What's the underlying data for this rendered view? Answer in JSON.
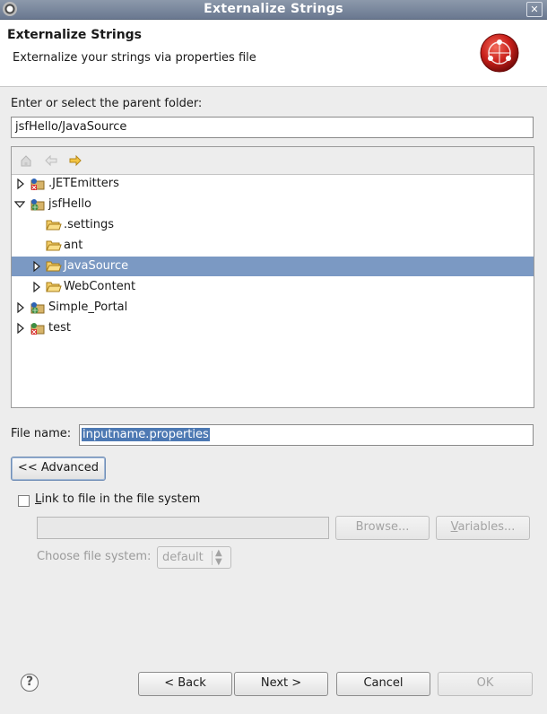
{
  "window": {
    "title": "Externalize Strings",
    "close": "✕"
  },
  "header": {
    "title": "Externalize Strings",
    "subtitle": "Externalize your strings via properties file"
  },
  "folder": {
    "label": "Enter or select the parent folder:",
    "value": "jsfHello/JavaSource"
  },
  "tree": {
    "items": [
      {
        "label": ".JETEmitters",
        "icon": "project-error-icon",
        "expanded": false
      },
      {
        "label": "jsfHello",
        "icon": "web-project-icon",
        "expanded": true
      },
      {
        "label": ".settings",
        "icon": "folder-icon"
      },
      {
        "label": "ant",
        "icon": "folder-icon"
      },
      {
        "label": "JavaSource",
        "icon": "folder-icon",
        "expanded": false,
        "selected": true
      },
      {
        "label": "WebContent",
        "icon": "folder-icon",
        "expanded": false
      },
      {
        "label": "Simple_Portal",
        "icon": "web-project-icon",
        "expanded": false
      },
      {
        "label": "test",
        "icon": "project-error-icon",
        "expanded": false
      }
    ]
  },
  "file": {
    "label": "File name:",
    "value": "inputname.properties"
  },
  "advanced": {
    "label": "<< Advanced"
  },
  "link": {
    "label_mnemonic": "L",
    "label_rest": "ink to file in the file system",
    "path_value": "",
    "browse_label": "Browse...",
    "variables_mnemonic": "V",
    "variables_rest": "ariables..."
  },
  "filesystem": {
    "label": "Choose file system:",
    "selected": "default"
  },
  "buttons": {
    "back": "< Back",
    "next": "Next >",
    "cancel": "Cancel",
    "ok": "OK"
  },
  "colors": {
    "selection": "#7b99c3",
    "titlebar": "#6a7890"
  }
}
